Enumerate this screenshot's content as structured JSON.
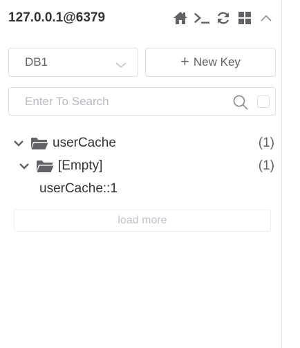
{
  "header": {
    "connection_title": "127.0.0.1@6379",
    "icons": [
      "home-icon",
      "terminal-icon",
      "refresh-icon",
      "grid-icon",
      "chevron-up-icon"
    ]
  },
  "toolbar": {
    "db_select_value": "DB1",
    "new_key_label": "New Key"
  },
  "search": {
    "placeholder": "Enter To Search"
  },
  "tree": {
    "folders": [
      {
        "label": "userCache",
        "count": "(1)"
      },
      {
        "label": "[Empty]",
        "count": "(1)"
      }
    ],
    "keys": [
      "userCache::1"
    ]
  },
  "load_more_label": "load more",
  "colors": {
    "icon_gray": "#606266",
    "border": "#dcdfe6",
    "muted_text": "#c0c4cc"
  }
}
